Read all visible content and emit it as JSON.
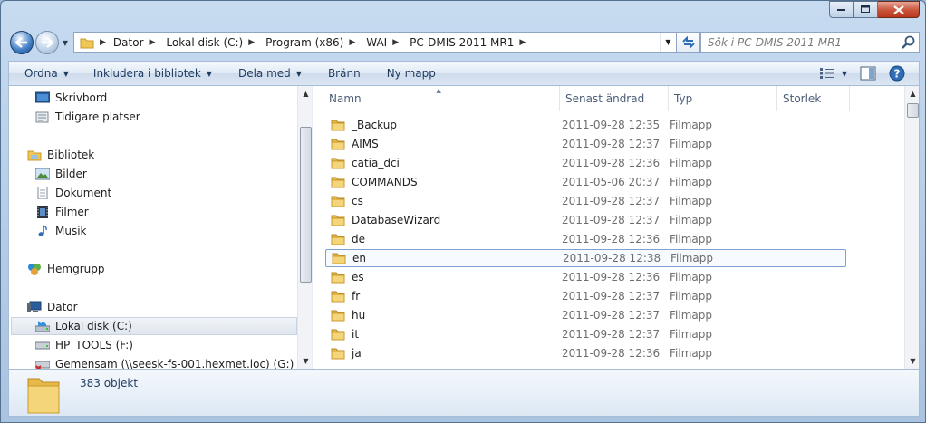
{
  "window": {
    "controls": [
      "minimize",
      "maximize",
      "close"
    ]
  },
  "address_bar": {
    "crumbs": [
      "Dator",
      "Lokal disk (C:)",
      "Program (x86)",
      "WAI",
      "PC-DMIS 2011 MR1"
    ]
  },
  "search": {
    "placeholder": "Sök i PC-DMIS 2011 MR1"
  },
  "toolbar": {
    "organize": "Ordna",
    "include_library": "Inkludera i bibliotek",
    "share": "Dela med",
    "burn": "Bränn",
    "new_folder": "Ny mapp"
  },
  "nav_pane": {
    "favorites": [
      "Skrivbord",
      "Tidigare platser"
    ],
    "libraries_header": "Bibliotek",
    "libraries": [
      "Bilder",
      "Dokument",
      "Filmer",
      "Musik"
    ],
    "homegroup": "Hemgrupp",
    "computer_header": "Dator",
    "drives": [
      "Lokal disk (C:)",
      "HP_TOOLS (F:)",
      "Gemensam (\\\\seesk-fs-001.hexmet.loc) (G:)"
    ],
    "selected": "Lokal disk (C:)"
  },
  "columns": [
    "Namn",
    "Senast ändrad",
    "Typ",
    "Storlek"
  ],
  "files": [
    {
      "name": "_Backup",
      "date": "2011-09-28 12:35",
      "type": "Filmapp"
    },
    {
      "name": "AIMS",
      "date": "2011-09-28 12:37",
      "type": "Filmapp"
    },
    {
      "name": "catia_dci",
      "date": "2011-09-28 12:36",
      "type": "Filmapp"
    },
    {
      "name": "COMMANDS",
      "date": "2011-05-06 20:37",
      "type": "Filmapp"
    },
    {
      "name": "cs",
      "date": "2011-09-28 12:37",
      "type": "Filmapp"
    },
    {
      "name": "DatabaseWizard",
      "date": "2011-09-28 12:37",
      "type": "Filmapp"
    },
    {
      "name": "de",
      "date": "2011-09-28 12:36",
      "type": "Filmapp"
    },
    {
      "name": "en",
      "date": "2011-09-28 12:38",
      "type": "Filmapp"
    },
    {
      "name": "es",
      "date": "2011-09-28 12:36",
      "type": "Filmapp"
    },
    {
      "name": "fr",
      "date": "2011-09-28 12:37",
      "type": "Filmapp"
    },
    {
      "name": "hu",
      "date": "2011-09-28 12:37",
      "type": "Filmapp"
    },
    {
      "name": "it",
      "date": "2011-09-28 12:37",
      "type": "Filmapp"
    },
    {
      "name": "ja",
      "date": "2011-09-28 12:36",
      "type": "Filmapp"
    }
  ],
  "highlighted_file": "en",
  "details": {
    "count": "383 objekt"
  },
  "colors": {
    "frame": "#b3cbe6",
    "folder": "#f0c755",
    "highlight_border": "#7da2ce",
    "close_button": "#c9543b"
  }
}
